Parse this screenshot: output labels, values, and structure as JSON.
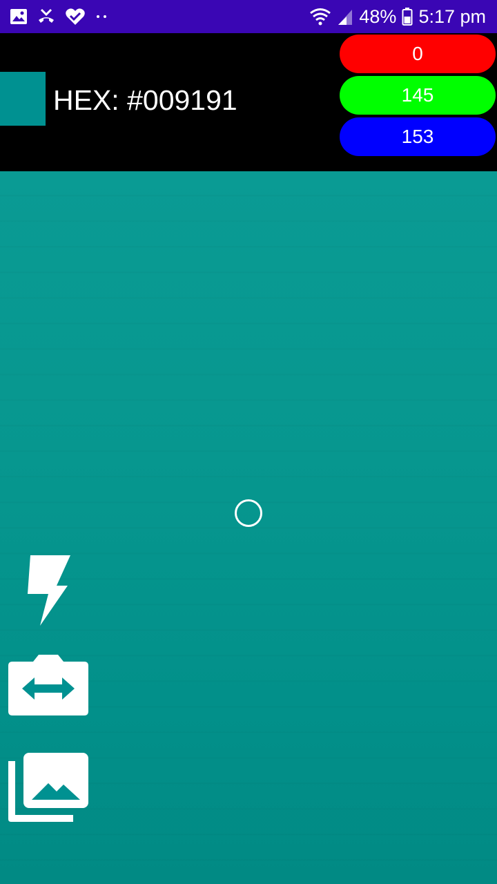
{
  "status_bar": {
    "battery_percent": "48%",
    "time": "5:17 pm",
    "background_color": "#3a06b4",
    "icons_left": [
      "gallery-notification-icon",
      "missed-call-icon",
      "health-check-icon",
      "more-dots-icon"
    ],
    "icons_right": [
      "wifi-icon",
      "signal-icon",
      "battery-icon"
    ]
  },
  "color_panel": {
    "hex_label": "HEX: #009191",
    "swatch_color": "#009191",
    "red_value": "0",
    "green_value": "145",
    "blue_value": "153",
    "red_pill_color": "#ff0000",
    "green_pill_color": "#00ff00",
    "blue_pill_color": "#0000ff"
  },
  "camera": {
    "crosshair": "target-circle"
  },
  "tools": {
    "flash": "flash-icon",
    "switch_camera": "switch-camera-icon",
    "gallery": "gallery-icon"
  }
}
